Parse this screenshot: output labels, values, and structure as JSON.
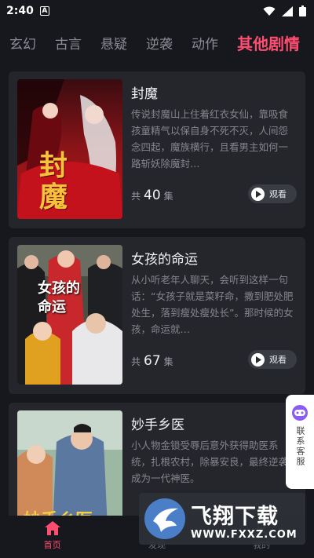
{
  "status": {
    "time": "2:40",
    "notification_letter": "A"
  },
  "tabs": [
    {
      "label": "玄幻"
    },
    {
      "label": "古言"
    },
    {
      "label": "悬疑"
    },
    {
      "label": "逆袭"
    },
    {
      "label": "动作"
    },
    {
      "label": "其他剧情"
    }
  ],
  "dramas": [
    {
      "title": "封魔",
      "desc": "传说封魔山上住着红衣女仙，靠吸食孩童精气以保自身不死不灭，人间怨念四起，魔族横行，且看男主如何一路斩妖除魔封…",
      "eps_prefix": "共",
      "eps_count": "40",
      "eps_suffix": "集",
      "watch_label": "观看",
      "poster_text": "封魔"
    },
    {
      "title": "女孩的命运",
      "desc": "从小听老年人聊天，会听到这样一句话：“女孩子就是菜籽命，撒到肥处肥处生，落到瘦处瘦处长”。那时候的女孩，命运就…",
      "eps_prefix": "共",
      "eps_count": "67",
      "eps_suffix": "集",
      "watch_label": "观看",
      "poster_text": "女孩的命运"
    },
    {
      "title": "妙手乡医",
      "desc": "小人物金锁受辱后意外获得助医系统，扎根农村，除暴安良，最终逆袭成为一代神医。",
      "poster_text": "妙手乡医"
    }
  ],
  "customer_service": {
    "label": "联系客服"
  },
  "bottom_nav": [
    {
      "label": "首页",
      "icon": "home-icon",
      "active": true
    },
    {
      "label": "发现",
      "icon": "discover-icon",
      "active": false
    },
    {
      "label": "我的",
      "icon": "profile-icon",
      "active": false
    }
  ],
  "watermark": {
    "title": "飞翔下载",
    "url": "WWW.FXXZ.COM"
  },
  "colors": {
    "background": "#17181d",
    "card": "#24262c",
    "accent": "#ff4d72",
    "muted": "#85868d"
  }
}
